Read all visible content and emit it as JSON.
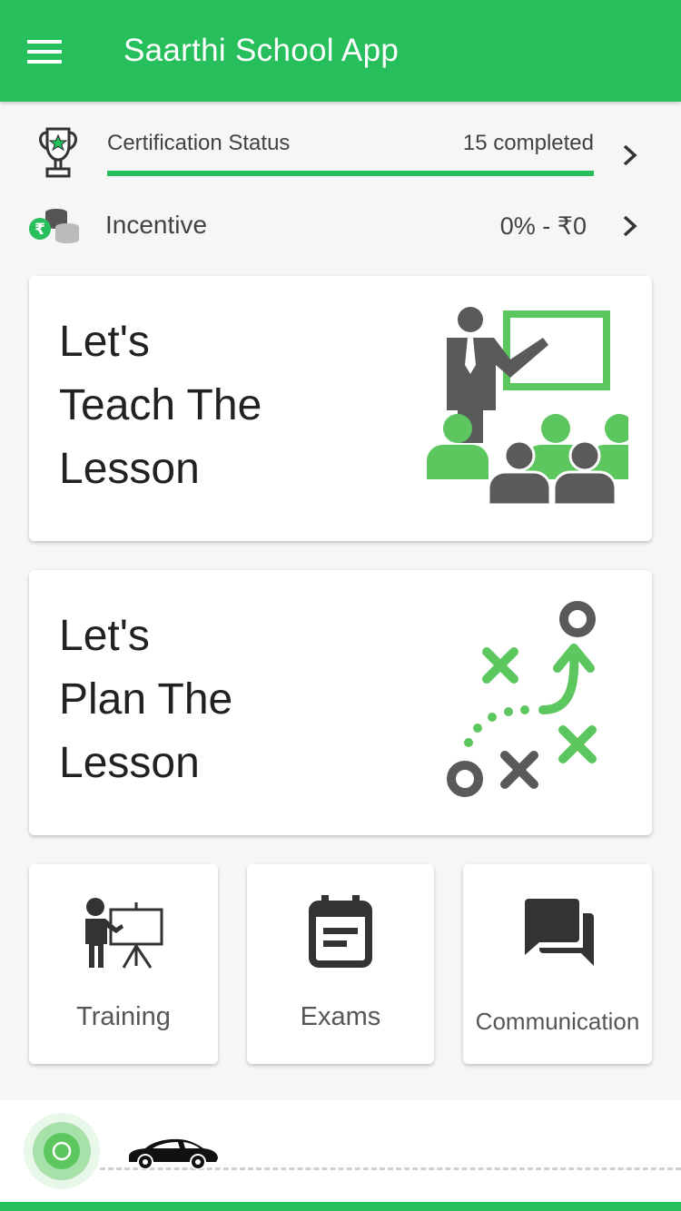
{
  "app_bar": {
    "title": "Saarthi School App",
    "menu_icon": "hamburger-menu-icon",
    "color": "#27bf5b"
  },
  "certification": {
    "label": "Certification Status",
    "value": "15 completed",
    "progress": 1.0,
    "icon": "trophy-icon"
  },
  "incentive": {
    "label": "Incentive",
    "value": "0% - ₹0",
    "icon": "coins-rupee-icon"
  },
  "cards": {
    "teach": {
      "lines": [
        "Let's",
        "Teach The",
        "Lesson"
      ],
      "icon": "teacher-classroom-icon"
    },
    "plan": {
      "lines": [
        "Let's",
        "Plan The",
        "Lesson"
      ],
      "icon": "strategy-plan-icon"
    }
  },
  "quick_links": [
    {
      "label": "Training",
      "icon": "trainer-board-icon"
    },
    {
      "label": "Exams",
      "icon": "calendar-icon"
    },
    {
      "label": "Communication",
      "icon": "chat-bubbles-icon"
    }
  ],
  "bottom_bar": {
    "location_icon": "location-dot-icon",
    "vehicle_icon": "car-icon"
  },
  "colors": {
    "accent_green": "#27bf5b",
    "icon_green": "#5cc75e",
    "icon_grey": "#5a5a5a"
  }
}
